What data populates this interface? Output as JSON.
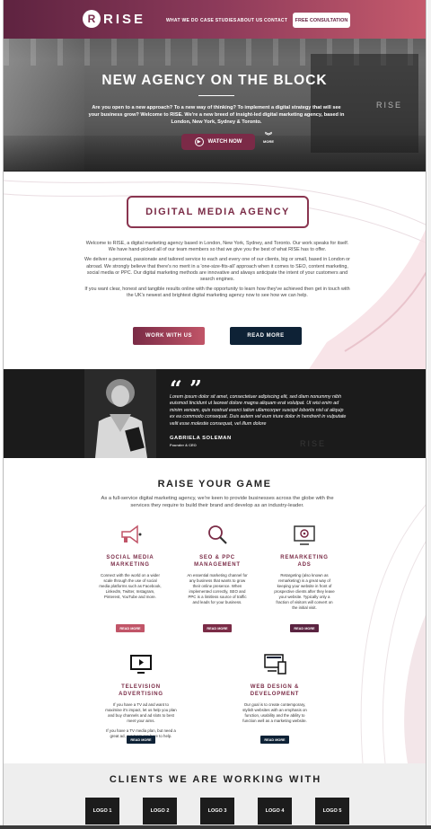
{
  "brand": {
    "name": "RISE",
    "mark": "R",
    "accent": "#7a2b46",
    "dark": "#0e2236"
  },
  "nav": {
    "links": [
      "WHAT WE DO",
      "CASE STUDIES",
      "ABOUT US",
      "CONTACT"
    ],
    "cta": "FREE CONSULTATION"
  },
  "hero": {
    "title": "NEW AGENCY ON THE BLOCK",
    "lead": "Are you open to a new approach? To a new way of thinking? To implement a digital strategy that will see your business grow? Welcome to RISE. We're a new breed of insight-led digital marketing agency, based in London, New York, Sydney & Toronto.",
    "watch_label": "WATCH NOW",
    "more_label": "MORE",
    "wall_sign": "RISE"
  },
  "agency": {
    "title": "DIGITAL MEDIA AGENCY",
    "paragraphs": [
      "Welcome to RISE, a digital marketing agency based in London, New York, Sydney, and Toronto. Our work speaks for itself. We have hand-picked all of our team members so that we give you the best of what RISE has to offer.",
      "We deliver a personal, passionate and tailored service to each and every one of our clients, big or small, based in London or abroad. We strongly believe that there's no merit in a 'one-size-fits-all' approach when it comes to SEO, content marketing, social media or PPC. Our digital marketing methods are innovative and always anticipate the intent of your customers and search engines.",
      "If you want clear, honest and tangible results online with the opportunity to learn how they've achieved then get in touch with the UK's newest and brightest digital marketing agency now to see how we can help."
    ],
    "work_button": "WORK WITH US",
    "read_button": "READ MORE"
  },
  "testimonial": {
    "quote_mark": "“ ”",
    "quote": "Lorem ipsum dolor sit amet, consectetuer adipiscing elit, sed diam nonummy nibh euismod tincidunt ut laoreet dolore magna aliquam erat volutpat. Ut wisi enim ad minim veniam, quis nostrud exerci tation ullamcorper suscipit lobortis nisl ut aliquip ex ea commodo consequat. Duis autem vel eum iriure dolor in hendrerit in vulputate velit esse molestie consequat, vel illum dolore",
    "name": "GABRIELA SOLEMAN",
    "role": "Founder & CEO",
    "bg_sign": "RISE"
  },
  "services": {
    "title": "RAISE YOUR GAME",
    "intro": "As a full-service digital marketing agency, we're keen to provide businesses across the globe with the services they require to build their brand and develop as an industry-leader.",
    "items": [
      {
        "title": "SOCIAL MEDIA MARKETING",
        "text": "Connect with the world on a wider scale through the use of social media platforms such as Facebook, LinkedIn, Twitter, Instagram, Pinterest, YouTube and more.",
        "button": "READ MORE",
        "icon": "megaphone-icon",
        "color": "#c15568"
      },
      {
        "title": "SEO & PPC MANAGEMENT",
        "text": "An essential marketing channel for any business that wants to grow their online presence. When implemented correctly, SEO and PPC is a limitless source of traffic and leads for your business.",
        "button": "READ MORE",
        "icon": "magnifier-icon",
        "color": "#7a2b46"
      },
      {
        "title": "REMARKETING ADS",
        "text": "Retargeting (also known as remarketing) is a great way of keeping your website in front of prospective clients after they leave your website. Typically only a fraction of visitors will convert on the initial visit.",
        "button": "READ MORE",
        "icon": "target-screen-icon",
        "color": "#5a2340"
      },
      {
        "title": "TELEVISION ADVERTISING",
        "text": "If you have a TV ad and want to maximise it's impact, let us help you plan and buy channels and ad slots to best meet your aims.",
        "text2": "If you have a TV media plan, but need a great ad, our team are here to help.",
        "button": "READ MORE",
        "icon": "television-icon",
        "color": "#0e2236"
      },
      {
        "title": "WEB DESIGN & DEVELOPMENT",
        "text": "Our goal is to create contemporary, stylish websites with an emphasis on function, usability and the ability to function well as a marketing website.",
        "button": "READ MORE",
        "icon": "devices-icon",
        "color": "#0e2236"
      }
    ]
  },
  "clients": {
    "title": "CLIENTS WE ARE WORKING WITH",
    "logos": [
      "LOGO 1",
      "LOGO 2",
      "LOGO 3",
      "LOGO 4",
      "LOGO 5"
    ]
  }
}
